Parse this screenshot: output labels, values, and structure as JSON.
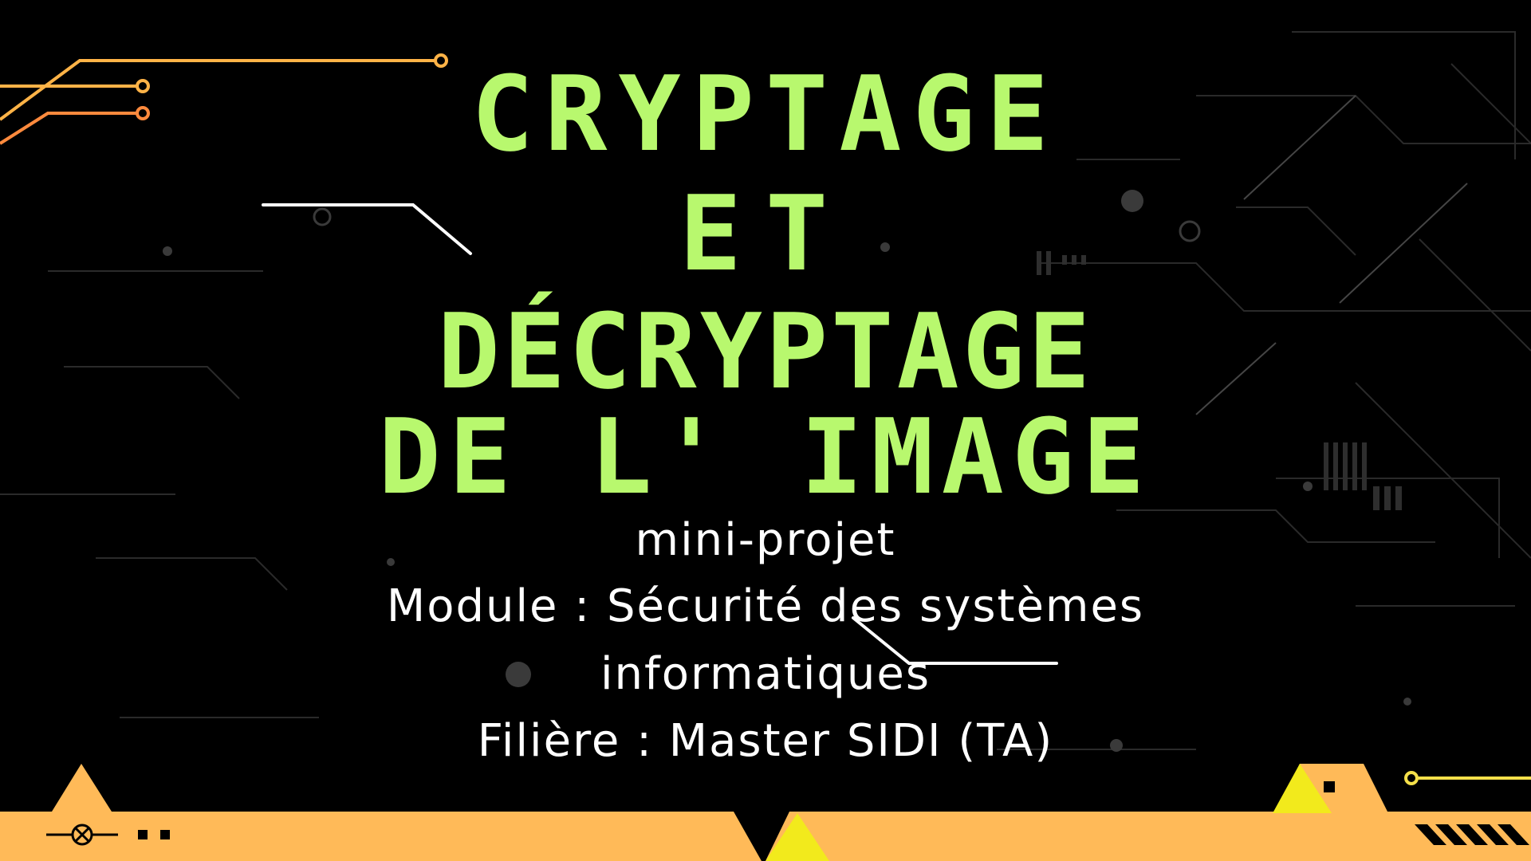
{
  "slide": {
    "title_lines": [
      "CRYPTAGE",
      "ET",
      "DÉCRYPTAGE",
      "DE L' IMAGE"
    ],
    "subtitle_lines": [
      "mini-projet",
      "Module : Sécurité des systèmes",
      "informatiques",
      "Filière : Master SIDI (TA)"
    ]
  },
  "colors": {
    "background": "#000000",
    "title": "#b8f86e",
    "subtitle": "#ffffff",
    "bottom_band": "#ffba58",
    "accent_yellow": "#f2ea1c",
    "circuit_orange": "#ff8a3d",
    "circuit_light_orange": "#ffb347",
    "circuit_yellow": "#f5e04a"
  },
  "icons": [
    "circuit-trace-icon",
    "crossed-circle-icon",
    "square-dots-icon",
    "hatched-stripes-icon"
  ]
}
